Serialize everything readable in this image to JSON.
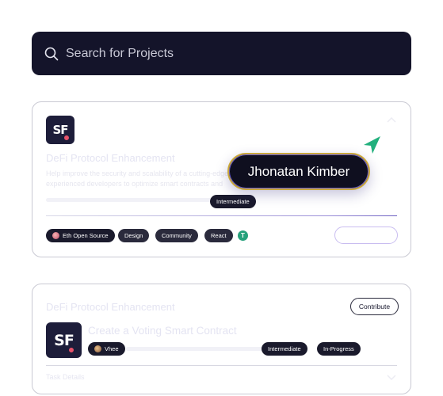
{
  "search": {
    "placeholder": "Search for Projects",
    "icon": "search-icon"
  },
  "card1": {
    "logo_text": "SF",
    "title": "DeFi Protocol Enhancement",
    "description_line1": "Help improve the security and scalability of a cutting-edge DeFi protocol. Collaborate with",
    "description_line2": "experienced developers to optimize smart contracts and",
    "level_badge": "Intermediate",
    "tags": [
      "Eth Open Source",
      "Design",
      "Community",
      "React"
    ],
    "token_icon": "tether-icon",
    "token_glyph": "T"
  },
  "tooltip": {
    "name": "Jhonatan Kimber"
  },
  "card2": {
    "logo_text": "SF",
    "project_title": "DeFi Protocol Enhancement",
    "task_title": "Create a Voting Smart Contract",
    "contribute_label": "Contribute",
    "assignee": "Vhee",
    "level_badge": "Intermediate",
    "status_badge": "In-Progress",
    "details_label": "Task Details"
  },
  "colors": {
    "search_bg": "#14142a",
    "card_border": "#c9c9d3",
    "tooltip_bg": "#0f0f1f",
    "tooltip_border": "#c9a73a",
    "cursor": "#22b07d",
    "tether": "#26a17b"
  }
}
